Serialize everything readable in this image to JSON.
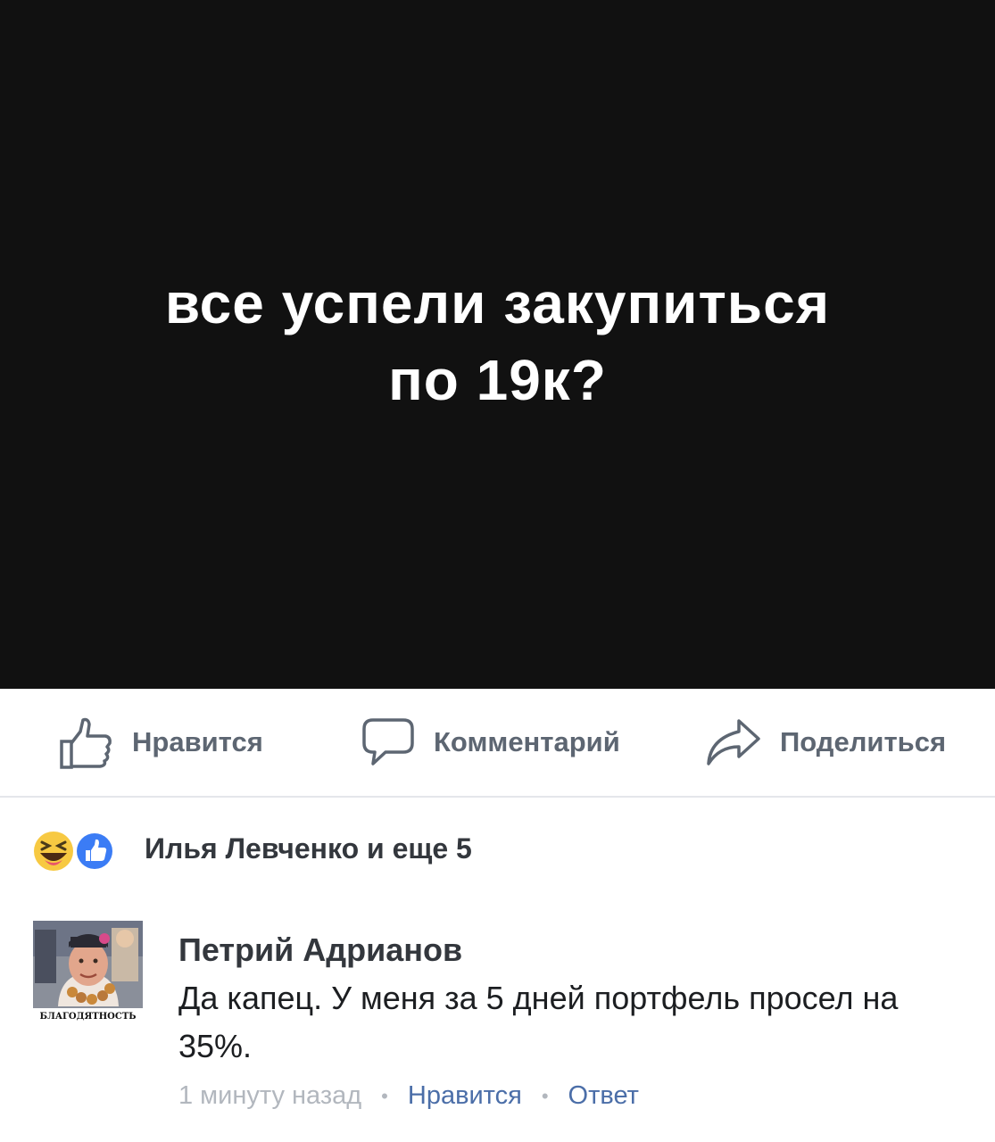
{
  "post": {
    "text_line1": "все успели закупиться",
    "text_line2": "по 19к?",
    "background": "#111111"
  },
  "actions": {
    "like_label": "Нравится",
    "comment_label": "Комментарий",
    "share_label": "Поделиться",
    "like_icon": "thumbs-up-outline-icon",
    "comment_icon": "speech-bubble-outline-icon",
    "share_icon": "share-arrow-outline-icon"
  },
  "reactions": {
    "icons": [
      "haha-reaction-icon",
      "like-reaction-icon"
    ],
    "summary": "Илья Левченко и еще 5"
  },
  "comment": {
    "author": "Петрий Адрианов",
    "text": "Да капец. У меня за 5 дней портфель просел на 35%.",
    "avatar_caption": "БЛАГОДЯТНОСТЬ",
    "time": "1 минуту назад",
    "like_label": "Нравится",
    "reply_label": "Ответ",
    "separator": "•"
  },
  "colors": {
    "action_text": "#5d6672",
    "link": "#4b6ea8",
    "muted": "#b2b7be",
    "like_blue": "#3b7cf5",
    "haha_yellow": "#f7c942"
  }
}
